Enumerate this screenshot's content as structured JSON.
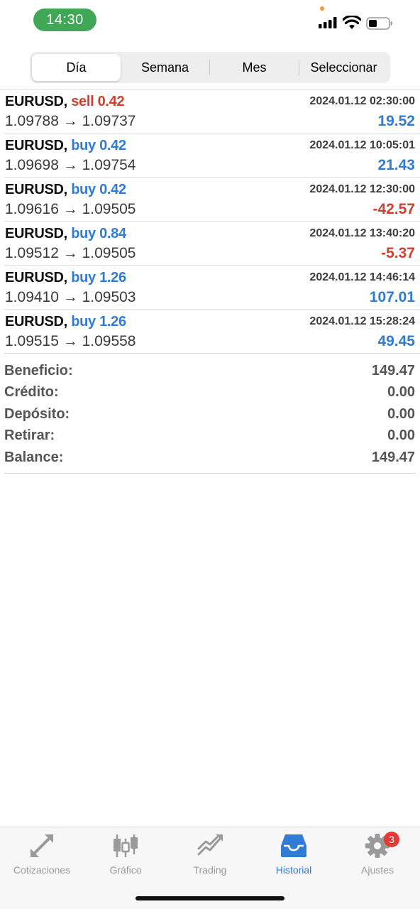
{
  "status_bar": {
    "time": "14:30"
  },
  "tabs_period": [
    {
      "label": "Día",
      "active": true
    },
    {
      "label": "Semana",
      "active": false
    },
    {
      "label": "Mes",
      "active": false
    },
    {
      "label": "Seleccionar",
      "active": false
    }
  ],
  "trades": [
    {
      "symbol": "EURUSD,",
      "side": "sell 0.42",
      "type": "sell",
      "time": "2024.01.12 02:30:00",
      "prices": "1.09788 → 1.09737",
      "profit": "19.52",
      "profit_sign": "pos"
    },
    {
      "symbol": "EURUSD,",
      "side": "buy 0.42",
      "type": "buy",
      "time": "2024.01.12 10:05:01",
      "prices": "1.09698 → 1.09754",
      "profit": "21.43",
      "profit_sign": "pos"
    },
    {
      "symbol": "EURUSD,",
      "side": "buy 0.42",
      "type": "buy",
      "time": "2024.01.12 12:30:00",
      "prices": "1.09616 → 1.09505",
      "profit": "-42.57",
      "profit_sign": "neg"
    },
    {
      "symbol": "EURUSD,",
      "side": "buy 0.84",
      "type": "buy",
      "time": "2024.01.12 13:40:20",
      "prices": "1.09512 → 1.09505",
      "profit": "-5.37",
      "profit_sign": "neg"
    },
    {
      "symbol": "EURUSD,",
      "side": "buy 1.26",
      "type": "buy",
      "time": "2024.01.12 14:46:14",
      "prices": "1.09410 → 1.09503",
      "profit": "107.01",
      "profit_sign": "pos"
    },
    {
      "symbol": "EURUSD,",
      "side": "buy 1.26",
      "type": "buy",
      "time": "2024.01.12 15:28:24",
      "prices": "1.09515 → 1.09558",
      "profit": "49.45",
      "profit_sign": "pos"
    }
  ],
  "summary": [
    {
      "label": "Beneficio:",
      "value": "149.47"
    },
    {
      "label": "Crédito:",
      "value": "0.00"
    },
    {
      "label": "Depósito:",
      "value": "0.00"
    },
    {
      "label": "Retirar:",
      "value": "0.00"
    },
    {
      "label": "Balance:",
      "value": "149.47"
    }
  ],
  "tabbar": [
    {
      "label": "Cotizaciones",
      "icon": "quotes-arrows-icon",
      "active": false
    },
    {
      "label": "Gráfico",
      "icon": "candlestick-icon",
      "active": false
    },
    {
      "label": "Trading",
      "icon": "trading-trend-icon",
      "active": false
    },
    {
      "label": "Historial",
      "icon": "inbox-tray-icon",
      "active": true
    },
    {
      "label": "Ajustes",
      "icon": "gear-icon",
      "active": false,
      "badge": "3"
    }
  ],
  "colors": {
    "buy": "#2f7bd6",
    "sell": "#d03f2e",
    "accent": "#2f7bd6",
    "time_pill": "#3fa755",
    "badge": "#e53935"
  }
}
